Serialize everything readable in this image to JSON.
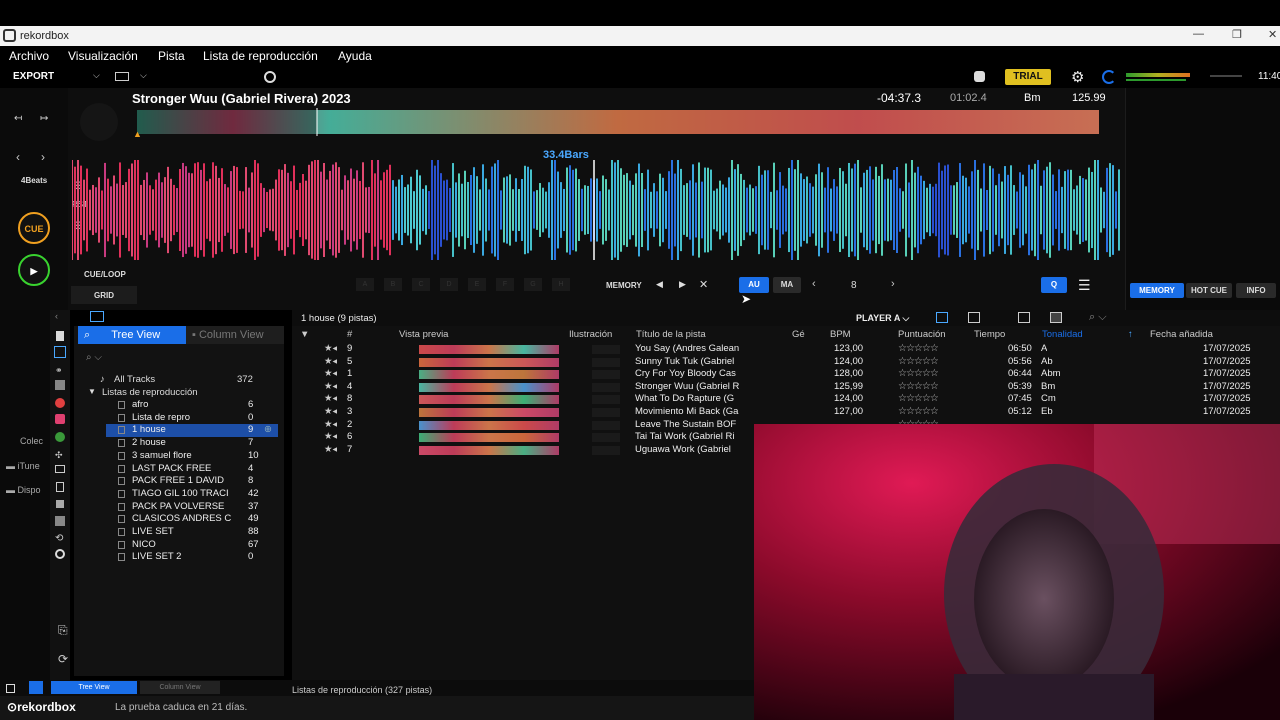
{
  "window": {
    "title": "rekordbox"
  },
  "menu": [
    "Archivo",
    "Visualización",
    "Pista",
    "Lista de reproducción",
    "Ayuda"
  ],
  "toolbar": {
    "export": "EXPORT",
    "trial": "TRIAL",
    "time": "11:40"
  },
  "deck": {
    "track_title": "Stronger Wuu (Gabriel Rivera) 2023",
    "remaining": "-04:37.3",
    "elapsed": "01:02.4",
    "key": "Bm",
    "bpm": "125.99",
    "bars": "33.4Bars",
    "beats": "4Beats",
    "cue": "CUE",
    "rst": "RST",
    "cue_loop": "CUE/LOOP",
    "grid": "GRID",
    "hotcue_slots": [
      "A",
      "B",
      "C",
      "D",
      "E",
      "F",
      "G",
      "H"
    ],
    "memory": "MEMORY",
    "au": "AU",
    "ma": "MA",
    "beat_value": "8",
    "q": "Q",
    "right_tabs": [
      "MEMORY",
      "HOT CUE",
      "INFO"
    ]
  },
  "browser": {
    "tabs": {
      "tree": "Tree View",
      "column": "Column View"
    },
    "side_labels": [
      "Colec",
      "iTune",
      "Dispo"
    ],
    "all_tracks": {
      "label": "All Tracks",
      "count": "372"
    },
    "playlists_label": "Listas de reproducción",
    "playlists": [
      {
        "name": "afro",
        "count": "6"
      },
      {
        "name": "Lista de repro",
        "count": "0"
      },
      {
        "name": "1 house",
        "count": "9",
        "selected": true
      },
      {
        "name": "2 house",
        "count": "7"
      },
      {
        "name": "3 samuel flore",
        "count": "10"
      },
      {
        "name": "LAST PACK FREE",
        "count": "4"
      },
      {
        "name": "PACK FREE 1 DAVID",
        "count": "8"
      },
      {
        "name": "TIAGO GIL 100 TRACI",
        "count": "42"
      },
      {
        "name": "PACK PA VOLVERSE",
        "count": "37"
      },
      {
        "name": "CLASICOS ANDRES C",
        "count": "49"
      },
      {
        "name": "LIVE SET",
        "count": "88"
      },
      {
        "name": "NICO",
        "count": "67"
      },
      {
        "name": "LIVE SET 2",
        "count": "0"
      }
    ],
    "list_title": "1 house (9 pistas)",
    "player": "PLAYER A",
    "columns": [
      "#",
      "Vista previa",
      "Ilustración",
      "Título de la pista",
      "Gé",
      "BPM",
      "Puntuación",
      "Tiempo",
      "Tonalidad",
      "Fecha añadida"
    ],
    "tracks": [
      {
        "num": "9",
        "title": "You Say (Andres Galean",
        "bpm": "123,00",
        "time": "06:50",
        "key": "A",
        "date": "17/07/2025"
      },
      {
        "num": "5",
        "title": "Sunny Tuk Tuk (Gabriel",
        "bpm": "124,00",
        "time": "05:56",
        "key": "Ab",
        "date": "17/07/2025"
      },
      {
        "num": "1",
        "title": "Cry For Yoy Bloody Cas",
        "bpm": "128,00",
        "time": "06:44",
        "key": "Abm",
        "date": "17/07/2025"
      },
      {
        "num": "4",
        "title": "Stronger Wuu (Gabriel R",
        "bpm": "125,99",
        "time": "05:39",
        "key": "Bm",
        "date": "17/07/2025"
      },
      {
        "num": "8",
        "title": "What To Do Rapture (G",
        "bpm": "124,00",
        "time": "07:45",
        "key": "Cm",
        "date": "17/07/2025"
      },
      {
        "num": "3",
        "title": "Movimiento Mi Back (Ga",
        "bpm": "127,00",
        "time": "05:12",
        "key": "Eb",
        "date": "17/07/2025"
      },
      {
        "num": "2",
        "title": "Leave The Sustain BOF",
        "bpm": "",
        "time": "",
        "key": "",
        "date": ""
      },
      {
        "num": "6",
        "title": "Tai Tai Work (Gabriel Ri",
        "bpm": "",
        "time": "",
        "key": "",
        "date": ""
      },
      {
        "num": "7",
        "title": "Uguawa Work (Gabriel",
        "bpm": "",
        "time": "",
        "key": "",
        "date": ""
      }
    ],
    "footer": "Listas de reproducción (327 pistas)"
  },
  "status": {
    "logo": "rekordbox",
    "message": "La prueba caduca en 21 días."
  },
  "colors": {
    "accent": "#1a6ee8",
    "cue": "#f0a020",
    "play": "#39d32f",
    "trial": "#e0c020"
  }
}
